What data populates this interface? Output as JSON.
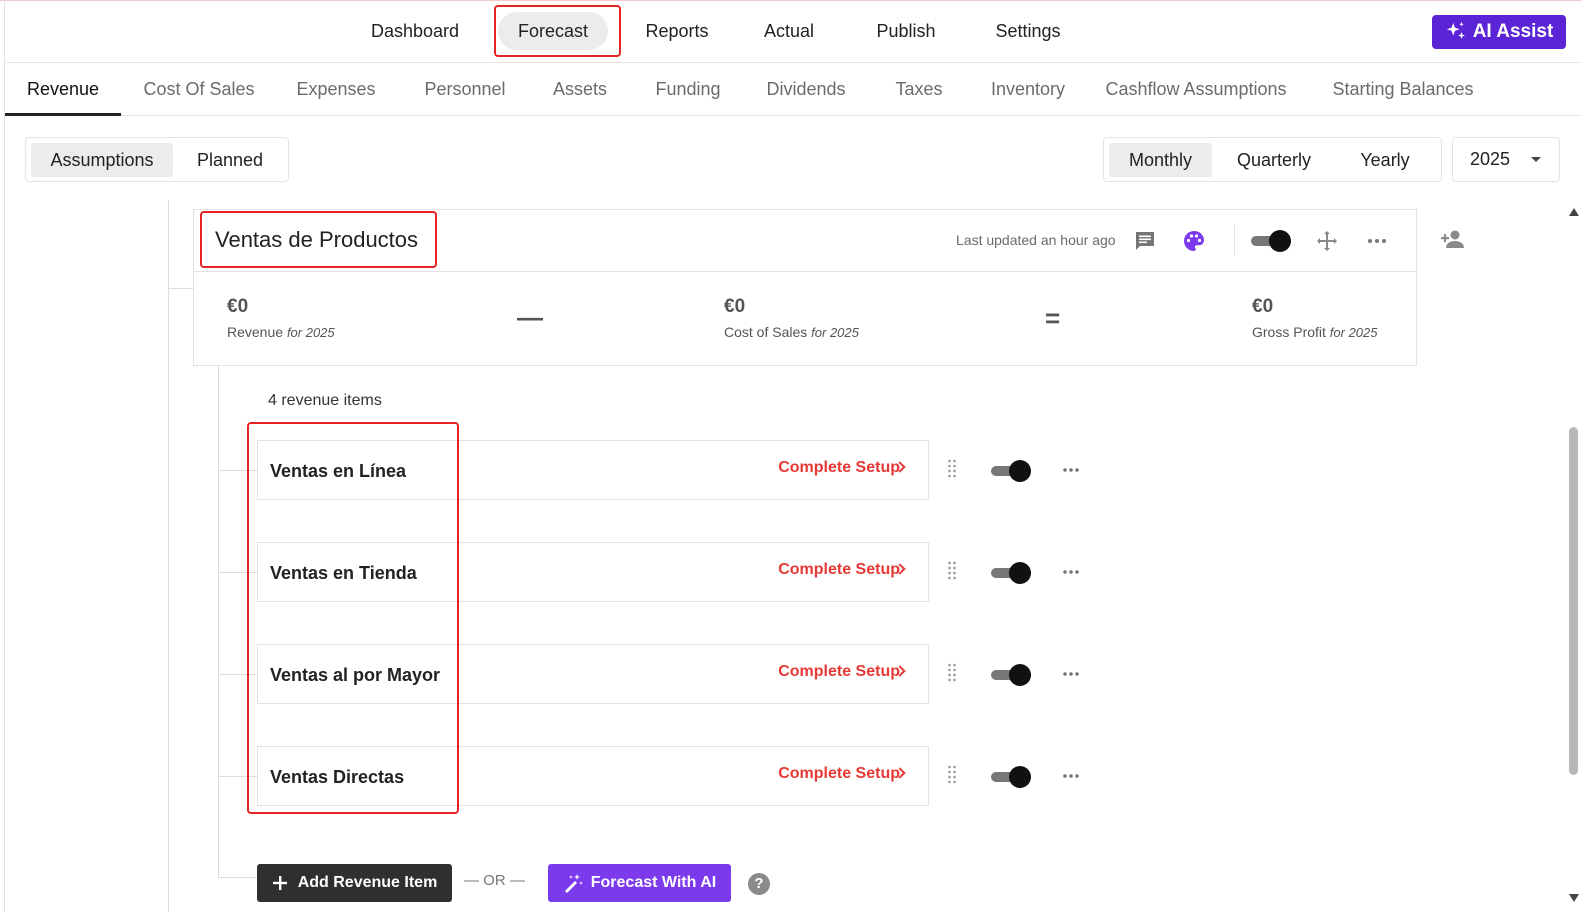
{
  "topnav": {
    "items": [
      "Dashboard",
      "Forecast",
      "Reports",
      "Actual",
      "Publish",
      "Settings"
    ],
    "active": "Forecast",
    "ai_assist_label": "AI Assist",
    "accent": "#5b24d6"
  },
  "subnav": {
    "tabs": [
      "Revenue",
      "Cost Of Sales",
      "Expenses",
      "Personnel",
      "Assets",
      "Funding",
      "Dividends",
      "Taxes",
      "Inventory",
      "Cashflow Assumptions",
      "Starting Balances"
    ],
    "active": "Revenue"
  },
  "view_toggle": {
    "options": [
      "Assumptions",
      "Planned"
    ],
    "active": "Assumptions"
  },
  "period_toggle": {
    "options": [
      "Monthly",
      "Quarterly",
      "Yearly"
    ],
    "active": "Monthly"
  },
  "year_select": {
    "value": "2025"
  },
  "stream": {
    "title": "Ventas de Productos",
    "updated": "Last updated an hour ago",
    "revenue": {
      "amount": "€0",
      "label": "Revenue",
      "period": "for 2025"
    },
    "minus_op": "—",
    "cost": {
      "amount": "€0",
      "label": "Cost of Sales",
      "period": "for 2025"
    },
    "equals_op": "=",
    "profit": {
      "amount": "€0",
      "label": "Gross Profit",
      "period": "for 2025"
    },
    "enabled": true
  },
  "items_count": "4 revenue items",
  "items": [
    {
      "name": "Ventas en Línea",
      "action": "Complete Setup",
      "enabled": true
    },
    {
      "name": "Ventas en Tienda",
      "action": "Complete Setup",
      "enabled": true
    },
    {
      "name": "Ventas al por Mayor",
      "action": "Complete Setup",
      "enabled": true
    },
    {
      "name": "Ventas Directas",
      "action": "Complete Setup",
      "enabled": true
    }
  ],
  "actions": {
    "add_label": "Add Revenue Item",
    "or_label": "OR",
    "ai_label": "Forecast With AI",
    "help_label": "?"
  },
  "colors": {
    "warning": "#e53935",
    "ai": "#7c3aed",
    "highlight": "#e42525"
  }
}
